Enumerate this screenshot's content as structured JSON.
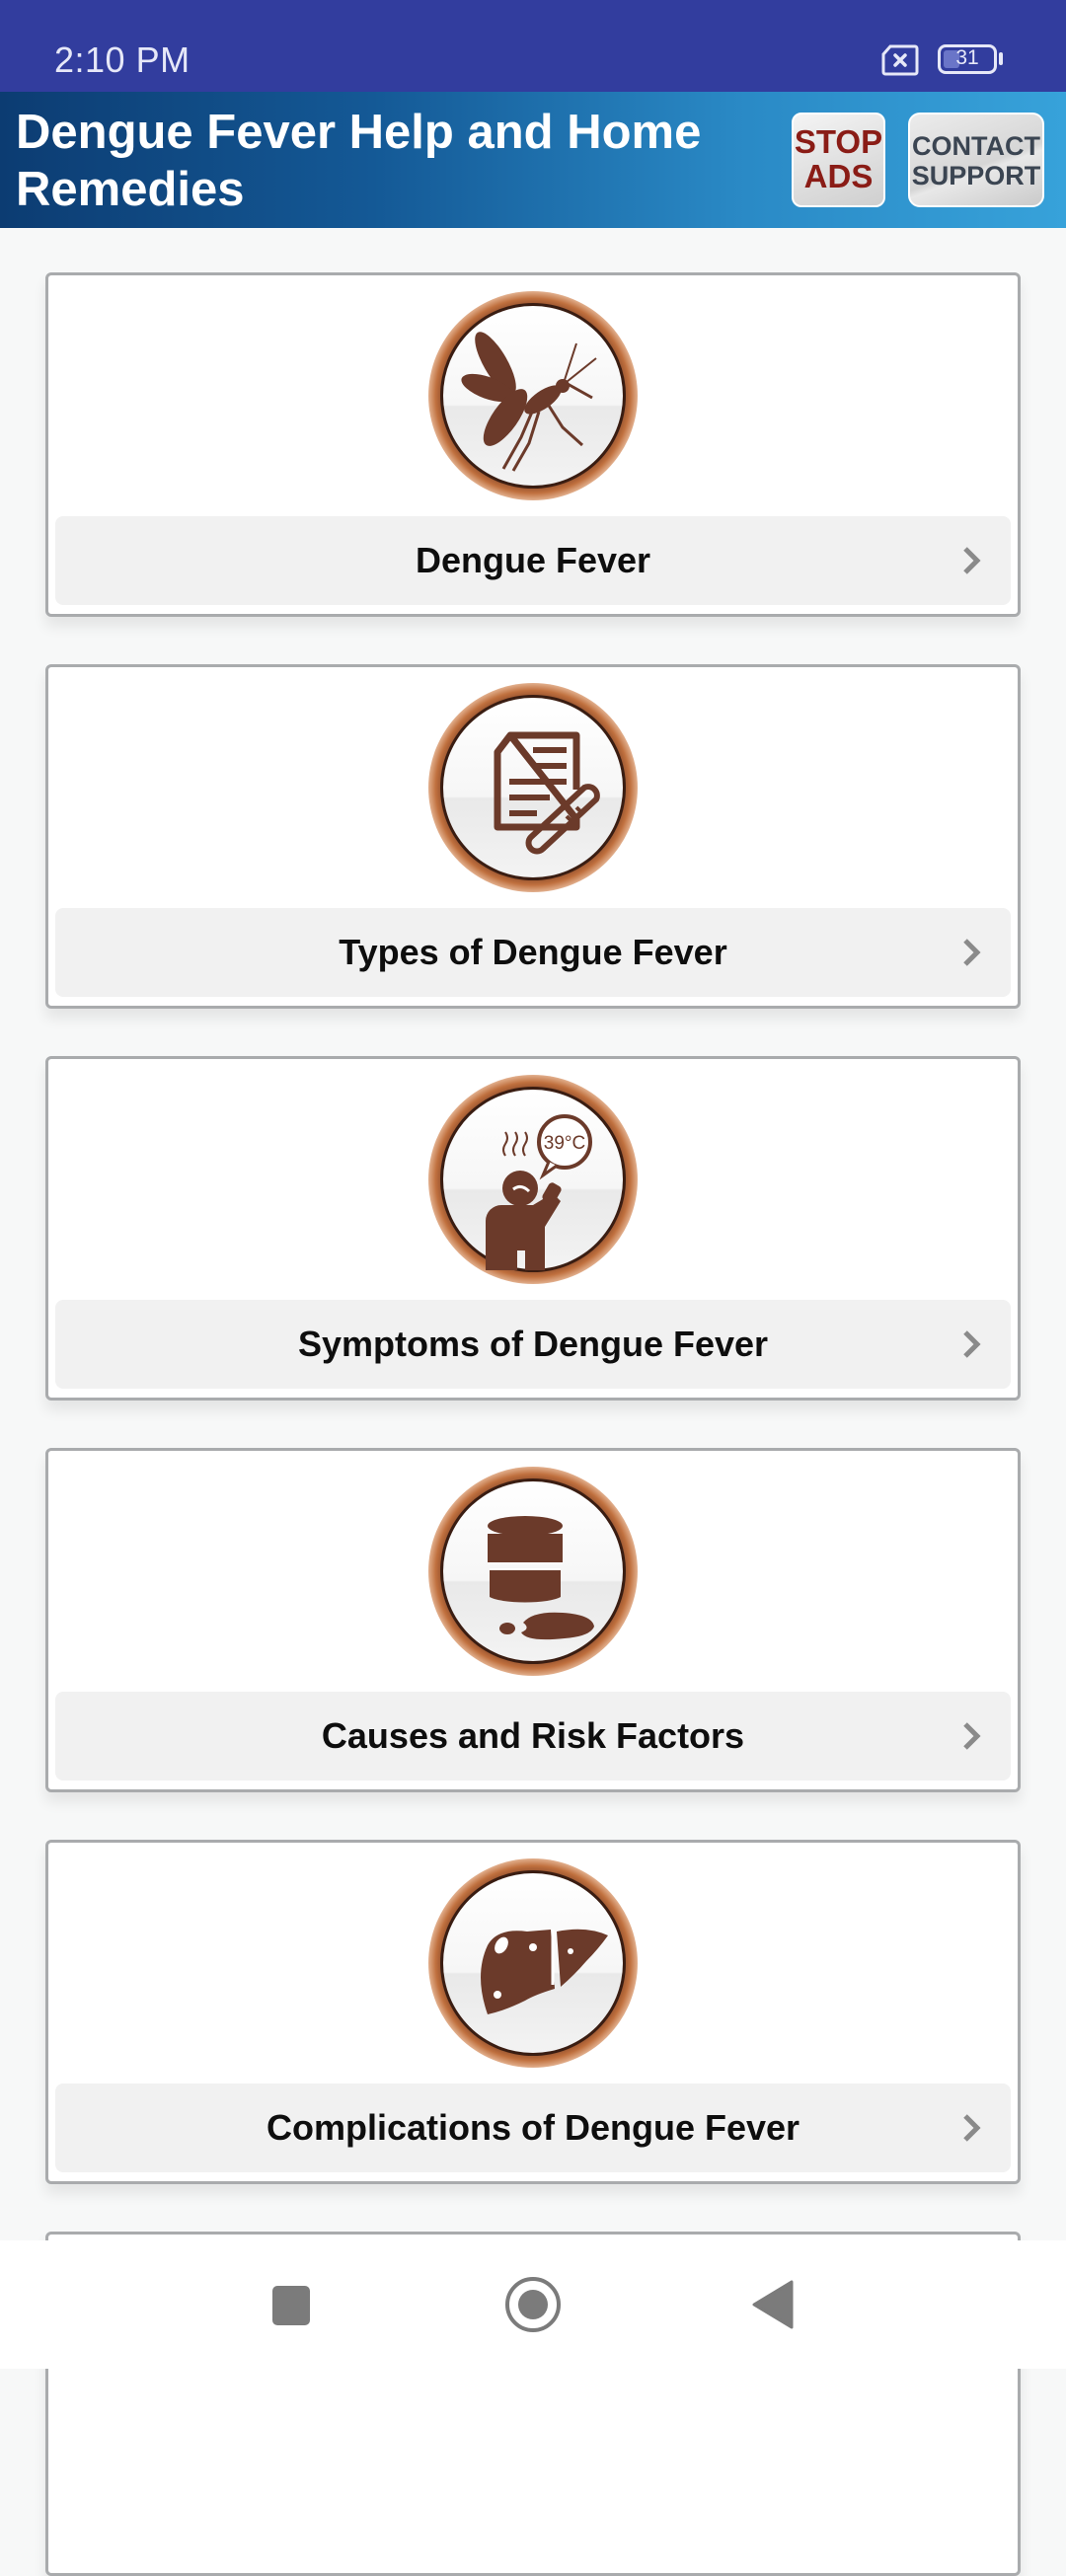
{
  "status_bar": {
    "time": "2:10 PM",
    "battery_level": "31",
    "battery_percent": 31,
    "sim_icon": "no-sim-icon"
  },
  "app_bar": {
    "title": "Dengue Fever Help and Home Remedies",
    "stop_ads": {
      "line1": "STOP",
      "line2": "ADS"
    },
    "contact_support": {
      "line1": "CONTACT",
      "line2": "SUPPORT"
    }
  },
  "colors": {
    "status_bar": "#323d9e",
    "app_bar_start": "#0c3c72",
    "app_bar_end": "#37a2da",
    "icon_brown": "#6b3a2a",
    "icon_ring": "#b9683a",
    "stop_ads_text": "#8a1c16"
  },
  "menu": {
    "items": [
      {
        "label": "Dengue Fever",
        "icon": "mosquito-icon"
      },
      {
        "label": "Types of Dengue Fever",
        "icon": "document-thermometer-icon"
      },
      {
        "label": "Symptoms of Dengue Fever",
        "icon": "fever-person-icon"
      },
      {
        "label": "Causes and Risk Factors",
        "icon": "barrel-spill-icon"
      },
      {
        "label": "Complications of Dengue Fever",
        "icon": "liver-icon"
      },
      {
        "label": "",
        "icon": ""
      }
    ]
  },
  "nav_bar": {
    "recents": "recents-icon",
    "home": "home-icon",
    "back": "back-icon"
  }
}
